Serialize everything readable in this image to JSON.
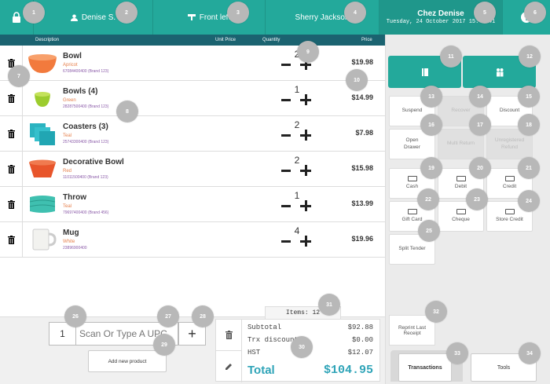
{
  "topbar": {
    "user": "Denise S.",
    "table": "Front left",
    "staff": "Sherry Jackson",
    "store_name": "Chez Denise",
    "datetime": "Tuesday, 24 October 2017 15:43:41"
  },
  "columns": {
    "description": "Description",
    "unit_price": "Unit Price",
    "quantity": "Quantity",
    "price": "Price"
  },
  "items": [
    {
      "name": "Bowl",
      "color": "Apricot",
      "sku": "67084400400 (Brand 123)",
      "qty": "2",
      "price": "$19.98"
    },
    {
      "name": "Bowls (4)",
      "color": "Green",
      "sku": "28287500400 (Brand 123)",
      "qty": "1",
      "price": "$14.99"
    },
    {
      "name": "Coasters (3)",
      "color": "Teal",
      "sku": "25743300400 (Brand 123)",
      "qty": "2",
      "price": "$7.98"
    },
    {
      "name": "Decorative Bowl",
      "color": "Red",
      "sku": "11011500400 (Brand 123)",
      "qty": "2",
      "price": "$15.98"
    },
    {
      "name": "Throw",
      "color": "Teal",
      "sku": "79697400400 (Brand 456)",
      "qty": "1",
      "price": "$13.99"
    },
    {
      "name": "Mug",
      "color": "White",
      "sku": "23896900400",
      "qty": "4",
      "price": "$19.96"
    }
  ],
  "actions": {
    "suspend": "Suspend",
    "recover": "Recover",
    "discount": "Discount",
    "open_drawer": "Open Drawer",
    "multi_return": "Multi Return",
    "unregistered_refund": "Unregistered Refund",
    "cash": "Cash",
    "debit": "Debit",
    "credit": "Credit",
    "gift_card": "Gift Card",
    "cheque": "Cheque",
    "store_credit": "Store Credit",
    "split_tender": "Split Tender",
    "reprint": "Reprint Last Receipt"
  },
  "tabs": {
    "transactions": "Transactions",
    "tools": "Tools"
  },
  "entry": {
    "qty": "1",
    "scan_placeholder": "Scan Or Type A UPC",
    "add_new": "Add new product"
  },
  "summary": {
    "items_count": "Items: 12",
    "subtotal_label": "Subtotal",
    "subtotal": "$92.88",
    "discount_label": "Trx discount",
    "discount": "$0.00",
    "hst_label": "HST",
    "hst": "$12.07",
    "total_label": "Total",
    "total": "$104.95"
  },
  "markers": [
    "1",
    "2",
    "3",
    "4",
    "5",
    "6",
    "7",
    "8",
    "9",
    "10",
    "11",
    "12",
    "13",
    "14",
    "15",
    "16",
    "17",
    "18",
    "19",
    "20",
    "21",
    "22",
    "23",
    "24",
    "25",
    "26",
    "27",
    "28",
    "29",
    "30",
    "31",
    "32",
    "33",
    "34"
  ],
  "colors": {
    "teal": "#23a99b",
    "header": "#1b6370",
    "total": "#2fa4b8",
    "sku": "#8a5aa8",
    "variant": "#e67e49",
    "marker": "#b8b8b8"
  }
}
